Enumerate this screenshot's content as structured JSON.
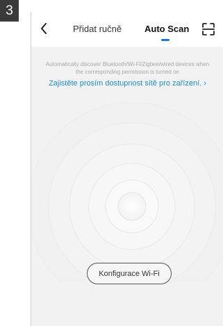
{
  "step_number": "3",
  "header": {
    "tab_manual": "Přidat ručně",
    "tab_auto": "Auto Scan",
    "back_icon": "chevron-left-icon",
    "scan_icon": "scan-frame-icon",
    "accent": "#1a73e8"
  },
  "info": {
    "line1": "Automatically discover Bluetooth/Wi-Fi/Zigbee/wired devices when",
    "line2": "the corresponding permission is turned on"
  },
  "link": {
    "text": "Zajistěte prosím dostupnost sítě pro zařízení.",
    "chevron": "›",
    "color": "#1a8fd9"
  },
  "wifi_button": {
    "label": "Konfigurace Wi-Fi"
  }
}
